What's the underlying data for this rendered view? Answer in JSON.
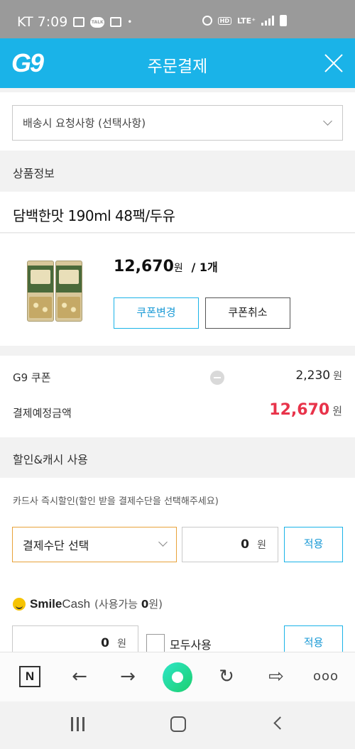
{
  "status_bar": {
    "carrier_time": "KT 7:09",
    "talk_icon_text": "TALK",
    "dot": "•",
    "hd": "HD",
    "lte": "LTE⁺"
  },
  "header": {
    "logo": "G9",
    "title": "주문결제"
  },
  "delivery": {
    "request_placeholder": "배송시 요청사항 (선택사항)"
  },
  "product_section": {
    "heading": "상품정보",
    "product_name": "담백한맛 190ml 48팩/두유",
    "price": "12,670",
    "price_unit": "원",
    "qty": "/ 1개",
    "coupon_change_label": "쿠폰변경",
    "coupon_cancel_label": "쿠폰취소"
  },
  "summary": {
    "coupon_label": "G9 쿠폰",
    "coupon_value": "2,230",
    "coupon_unit": "원",
    "total_label": "결제예정금액",
    "total_value": "12,670",
    "total_unit": "원"
  },
  "discount_section": {
    "heading": "할인&캐시 사용",
    "card_hint": "카드사 즉시할인(할인 받을 결제수단을 선택해주세요)",
    "payment_select_label": "결제수단 선택",
    "card_amount": "0",
    "card_amount_unit": "원",
    "apply_label": "적용",
    "smilecash_brand_bold": "Smile",
    "smilecash_brand_rest": "Cash",
    "smilecash_avail_prefix": "(사용가능 ",
    "smilecash_avail_amount": "0",
    "smilecash_avail_suffix": "원)",
    "cash_amount": "0",
    "cash_amount_unit": "원",
    "use_all_label": "모두사용",
    "cash_apply_label": "적용"
  },
  "toolbar": {
    "n_label": "N",
    "back": "←",
    "forward": "→",
    "refresh": "↻",
    "share": "⇨",
    "more": "ooo"
  },
  "colors": {
    "brand": "#1ab3e8",
    "price_red": "#e8334a",
    "payment_select_border": "#e8a23a"
  }
}
